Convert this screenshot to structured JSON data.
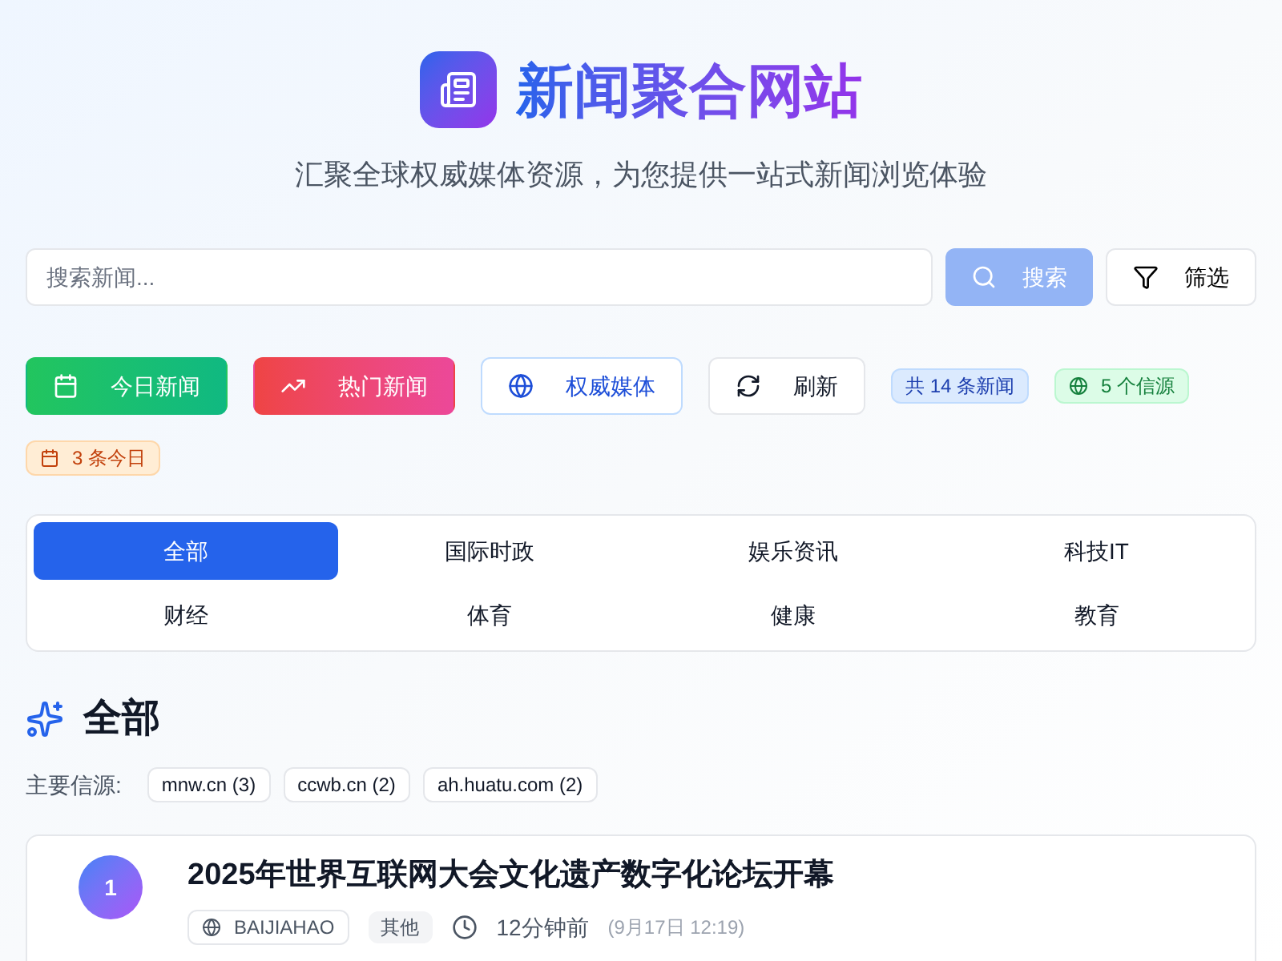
{
  "header": {
    "title": "新闻聚合网站",
    "subtitle": "汇聚全球权威媒体资源，为您提供一站式新闻浏览体验"
  },
  "search": {
    "placeholder": "搜索新闻...",
    "search_button": "搜索",
    "filter_button": "筛选"
  },
  "actions": [
    {
      "kind": "today",
      "label": "今日新闻"
    },
    {
      "kind": "hot",
      "label": "热门新闻"
    },
    {
      "kind": "media",
      "label": "权威媒体"
    },
    {
      "kind": "refresh",
      "label": "刷新"
    }
  ],
  "stats": [
    {
      "kind": "total",
      "label": "共 14 条新闻"
    },
    {
      "kind": "sources",
      "label": "5 个信源"
    },
    {
      "kind": "today",
      "label": "3 条今日"
    }
  ],
  "categories": [
    {
      "label": "全部",
      "selected": true
    },
    {
      "label": "国际时政",
      "selected": false
    },
    {
      "label": "娱乐资讯",
      "selected": false
    },
    {
      "label": "科技IT",
      "selected": false
    },
    {
      "label": "财经",
      "selected": false
    },
    {
      "label": "体育",
      "selected": false
    },
    {
      "label": "健康",
      "selected": false
    },
    {
      "label": "教育",
      "selected": false
    }
  ],
  "section": {
    "title": "全部",
    "sources_label": "主要信源:",
    "sources": [
      "mnw.cn (3)",
      "ccwb.cn (2)",
      "ah.huatu.com (2)"
    ]
  },
  "articles": [
    {
      "rank": "1",
      "title": "2025年世界互联网大会文化遗产数字化论坛开幕",
      "source": "BAIJIAHAO",
      "category": "其他",
      "time": "12分钟前",
      "date": "(9月17日 12:19)"
    }
  ]
}
